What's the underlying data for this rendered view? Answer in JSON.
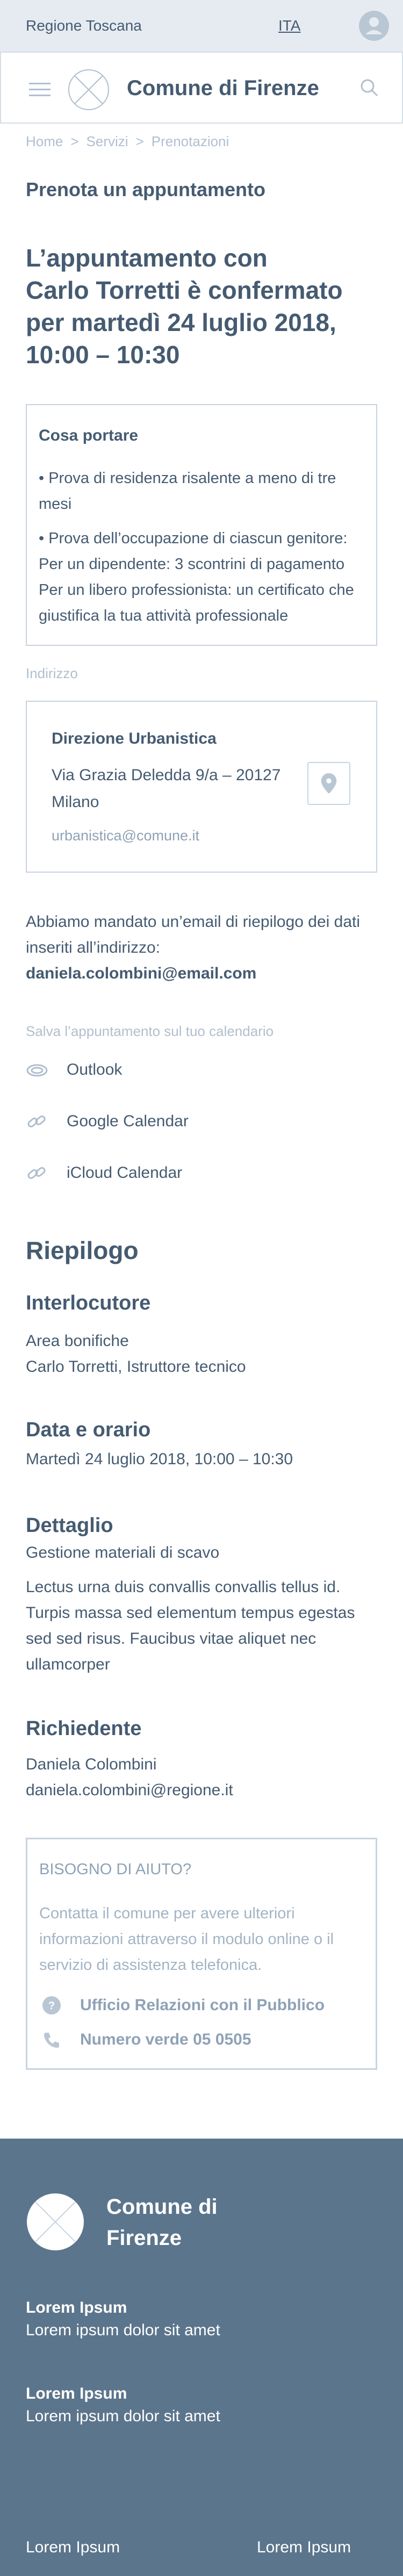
{
  "topbar": {
    "region": "Regione Toscana",
    "language": "ITA"
  },
  "header": {
    "title": "Comune di Firenze"
  },
  "breadcrumb": {
    "items": [
      "Home",
      "Servizi",
      "Prenotazioni"
    ]
  },
  "page_title": "Prenota un appuntamento",
  "confirmation": {
    "line1": "L’appuntamento con",
    "line2": "Carlo Torretti è confermato",
    "line3": "per martedì 24 luglio 2018,",
    "line4": "10:00 – 10:30"
  },
  "bring": {
    "title": "Cosa portare",
    "item1": "• Prova di residenza risalente a meno di tre mesi",
    "item2": "• Prova dell’occupazione di ciascun genitore: Per un dipendente: 3 scontrini di pagamento Per un libero professionista: un certificato che giustifica la tua attività professionale"
  },
  "address": {
    "label": "Indirizzo",
    "office": "Direzione Urbanistica",
    "street_line1": "Via Grazia Deledda 9/a – 20127",
    "street_line2": "Milano",
    "email": "urbanistica@comune.it"
  },
  "sent": {
    "text": "Abbiamo mandato un’email di riepilogo dei dati inseriti all’indirizzo:",
    "email": "daniela.colombini@email.com"
  },
  "calendar": {
    "label": "Salva l’appuntamento sul tuo calendario",
    "items": [
      {
        "label": "Outlook",
        "icon": "outlook-icon"
      },
      {
        "label": "Google Calendar",
        "icon": "link-icon"
      },
      {
        "label": "iCloud Calendar",
        "icon": "link-icon"
      }
    ]
  },
  "summary": {
    "title": "Riepilogo",
    "interlocutor_title": "Interlocutore",
    "interlocutor_line1": "Area bonifiche",
    "interlocutor_line2": "Carlo Torretti, Istruttore tecnico",
    "datetime_title": "Data e orario",
    "datetime_value": "Martedì 24 luglio 2018, 10:00 – 10:30",
    "detail_title": "Dettaglio",
    "detail_subject": "Gestione materiali di scavo",
    "detail_text": "Lectus urna duis convallis convallis tellus id. Turpis massa sed elementum tempus egestas sed sed risus. Faucibus vitae aliquet nec ullamcorper",
    "applicant_title": "Richiedente",
    "applicant_name": "Daniela Colombini",
    "applicant_email": "daniela.colombini@regione.it"
  },
  "help": {
    "title": "BISOGNO DI AIUTO?",
    "text": "Contatta il comune per avere ulteriori informazioni attraverso il modulo online o il servizio di assistenza telefonica.",
    "office": "Ufficio Relazioni con il Pubblico",
    "phone": "Numero verde 05 0505"
  },
  "footer": {
    "title_line1": "Comune di",
    "title_line2": "Firenze",
    "block1_title": "Lorem Ipsum",
    "block1_text": "Lorem ipsum dolor sit amet",
    "block2_title": "Lorem Ipsum",
    "block2_text": "Lorem ipsum dolor sit amet",
    "link_left": "Lorem Ipsum",
    "link_right": "Lorem Ipsum"
  },
  "colors": {
    "primary_text": "#455b71",
    "muted_text": "#b0bfce",
    "topbar_bg": "#e6ebf2",
    "footer_bg": "#5b758c",
    "border": "#c8d3df"
  }
}
